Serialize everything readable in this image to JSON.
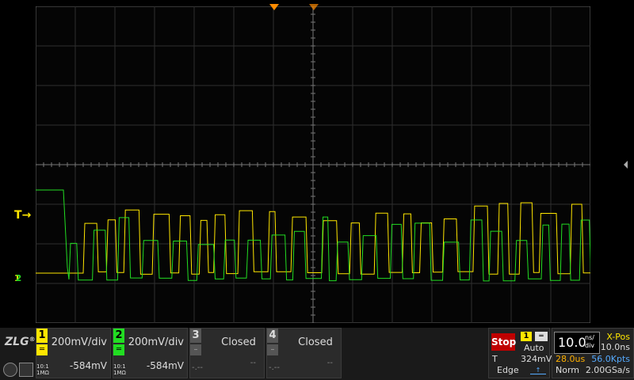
{
  "screen": {
    "trigger_level_label": "T",
    "ch_ref_label_1": "1",
    "ch_ref_label_2": "2"
  },
  "channels": [
    {
      "number": "1",
      "color": "#ffe600",
      "coupling": "DC",
      "probe": "10:1",
      "impedance": "1MΩ",
      "scale": "200mV/div",
      "offset": "-584mV"
    },
    {
      "number": "2",
      "color": "#22dd22",
      "coupling": "DC",
      "probe": "10:1",
      "impedance": "1MΩ",
      "scale": "200mV/div",
      "offset": "-584mV"
    },
    {
      "number": "3",
      "status": "Closed",
      "dash_left": "-.--",
      "dash_right": "--"
    },
    {
      "number": "4",
      "status": "Closed",
      "dash_left": "-.--",
      "dash_right": "--"
    }
  ],
  "run_state": "Stop",
  "trigger": {
    "source": "1",
    "mode": "Auto",
    "type_label": "T",
    "level": "324mV",
    "edge": "Edge"
  },
  "timebase": {
    "value": "10.0",
    "unit_top": "ns/",
    "unit_bottom": "div",
    "delay": "28.0us",
    "memory": "56.0Kpts",
    "acq_mode": "Norm",
    "sample_rate": "2.00GSa/s"
  },
  "xpos": {
    "label": "X-Pos",
    "value": "10.0ns"
  },
  "logo": "ZLG",
  "colors": {
    "ch1": "#ffe600",
    "ch2": "#22dd22",
    "trigger_marker": "#ff8c00",
    "stop": "#c00000"
  }
}
